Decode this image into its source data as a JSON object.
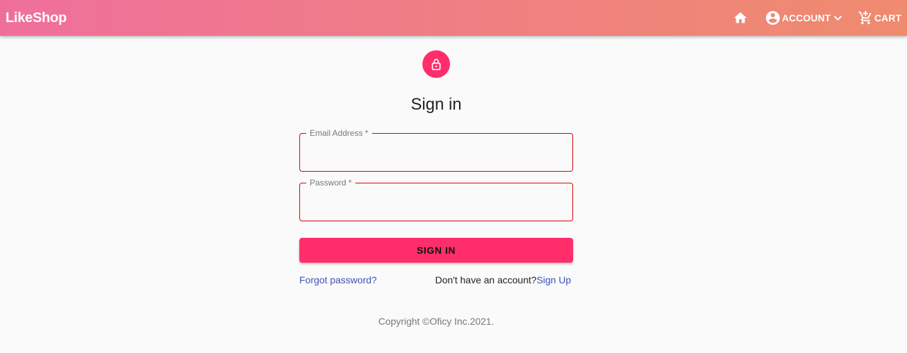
{
  "header": {
    "brand": "LikeShop",
    "nav": {
      "account_label": "ACCOUNT",
      "cart_label": "CART"
    }
  },
  "icons": {
    "home": "home-icon",
    "account": "account-circle-icon",
    "account_menu": "chevron-down-icon",
    "cart": "add-shopping-cart-icon",
    "avatar": "lock-open-icon"
  },
  "form": {
    "title": "Sign in",
    "email": {
      "label": "Email Address *",
      "value": ""
    },
    "password": {
      "label": "Password *",
      "value": ""
    },
    "submit_label": "SIGN IN"
  },
  "links": {
    "forgot": "Forgot password?",
    "no_account": "Don't have an account?",
    "signup": "Sign Up"
  },
  "footer": {
    "copyright": "Copyright ©Oficy Inc.2021."
  },
  "colors": {
    "header_gradient_start": "#ef6f9c",
    "header_gradient_end": "#ef8b6e",
    "accent": "#ff2e6a",
    "error": "#d50000",
    "link": "#3f51b5"
  }
}
